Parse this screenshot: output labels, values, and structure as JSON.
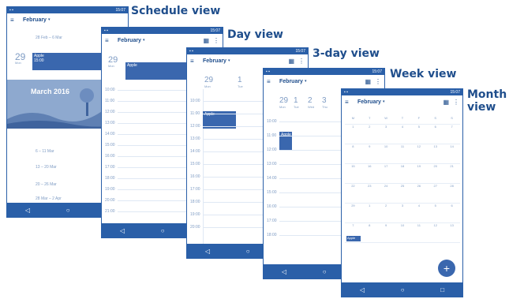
{
  "captions": {
    "schedule": "Schedule view",
    "day": "Day view",
    "three_day": "3-day view",
    "week": "Week view",
    "month_line1": "Month",
    "month_line2": "view"
  },
  "status_time": "15:07",
  "month": "February",
  "month_caret": "▾",
  "nav": {
    "back": "◁",
    "home": "○",
    "recents": "□"
  },
  "schedule": {
    "week_range": "28 Feb – 6 Mar",
    "day_num": "29",
    "day_label": "Mon",
    "event_title": "Apple",
    "event_time": "15:00",
    "banner": "March 2016",
    "ranges": [
      "6 – 11 Mar",
      "13 – 20 Mar",
      "20 – 26 Mar",
      "28 Mar – 2 Apr"
    ]
  },
  "day": {
    "day_num": "29",
    "day_label": "Mon",
    "event_title": "Apple",
    "hours": [
      "10:00",
      "11:00",
      "12:00",
      "13:00",
      "14:00",
      "15:00",
      "16:00",
      "17:00",
      "18:00",
      "19:00",
      "20:00",
      "21:00"
    ]
  },
  "three_day": {
    "days": [
      {
        "num": "29",
        "label": "Mon"
      },
      {
        "num": "1",
        "label": "Tue"
      }
    ],
    "event_title": "Apple",
    "hours": [
      "10:00",
      "11:00",
      "12:00",
      "13:00",
      "14:00",
      "15:00",
      "16:00",
      "17:00",
      "18:00",
      "19:00",
      "20:00"
    ]
  },
  "week": {
    "days": [
      {
        "num": "29",
        "label": "Mon"
      },
      {
        "num": "1",
        "label": "Tue"
      },
      {
        "num": "2",
        "label": "Wed"
      },
      {
        "num": "3",
        "label": "Thu"
      }
    ],
    "event_title": "Apple",
    "hours": [
      "10:00",
      "11:00",
      "12:00",
      "13:00",
      "14:00",
      "15:00",
      "16:00",
      "17:00",
      "18:00"
    ]
  },
  "month_view": {
    "weekdays": [
      "M",
      "T",
      "W",
      "T",
      "F",
      "S",
      "S"
    ],
    "rows": [
      [
        "1",
        "2",
        "3",
        "4",
        "5",
        "6",
        "7"
      ],
      [
        "8",
        "9",
        "10",
        "11",
        "12",
        "13",
        "14"
      ],
      [
        "15",
        "16",
        "17",
        "18",
        "19",
        "20",
        "21"
      ],
      [
        "22",
        "23",
        "24",
        "25",
        "26",
        "27",
        "28"
      ],
      [
        "29",
        "1",
        "2",
        "3",
        "4",
        "5",
        "6"
      ],
      [
        "7",
        "8",
        "9",
        "10",
        "11",
        "12",
        "13"
      ]
    ],
    "event_title": "Apple",
    "fab": "+"
  }
}
